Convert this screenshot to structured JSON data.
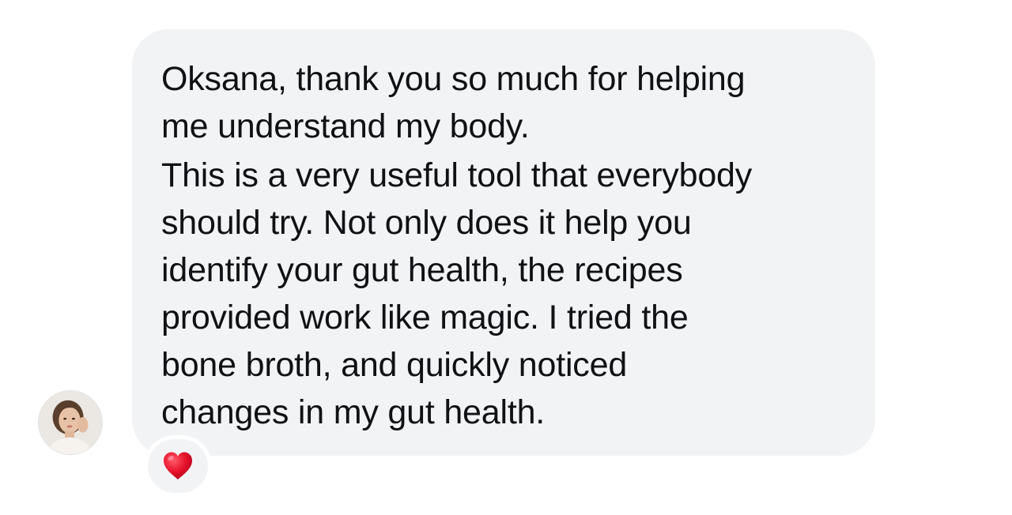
{
  "message": {
    "paragraphs": [
      {
        "lines": [
          "Oksana, thank you so much for helping",
          "me understand my body."
        ]
      },
      {
        "lines": [
          "This is a very useful tool that everybody",
          "should try. Not only does it help you",
          "identify your gut health, the recipes",
          "provided work like magic. I tried the",
          "bone broth, and quickly noticed",
          "changes in my gut health."
        ]
      }
    ],
    "bubble_color": "#f2f3f5",
    "text_color": "#101114"
  },
  "sender": {
    "avatar_icon": "user-avatar-photo"
  },
  "reaction": {
    "icon": "red-heart-icon",
    "color": "#e8142d"
  }
}
